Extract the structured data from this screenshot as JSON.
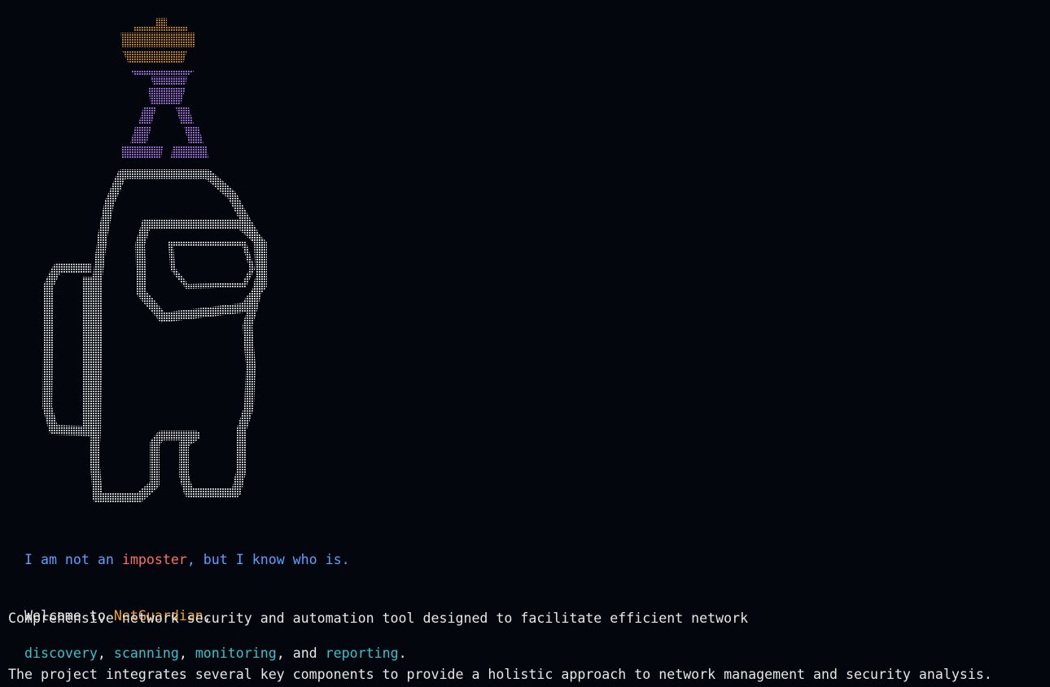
{
  "art": {
    "hat_color": "#d9941f",
    "figure_color": "#b07cf0",
    "crewmate_color": "#e8e8e8"
  },
  "tagline": {
    "part1": "I am not an ",
    "highlight": "imposter",
    "part2": ", but I know who is."
  },
  "welcome": {
    "prefix": "Welcome to ",
    "name": "NetGuardian",
    "suffix": ","
  },
  "description": {
    "line1": "Comprehensive network security and automation tool designed to facilitate efficient network",
    "features": [
      "discovery",
      "scanning",
      "monitoring",
      "reporting"
    ],
    "sep1": ", ",
    "sep2": ", ",
    "sep3": ", and ",
    "end": "."
  },
  "project_line": "The project integrates several key components to provide a holistic approach to network management and security analysis."
}
